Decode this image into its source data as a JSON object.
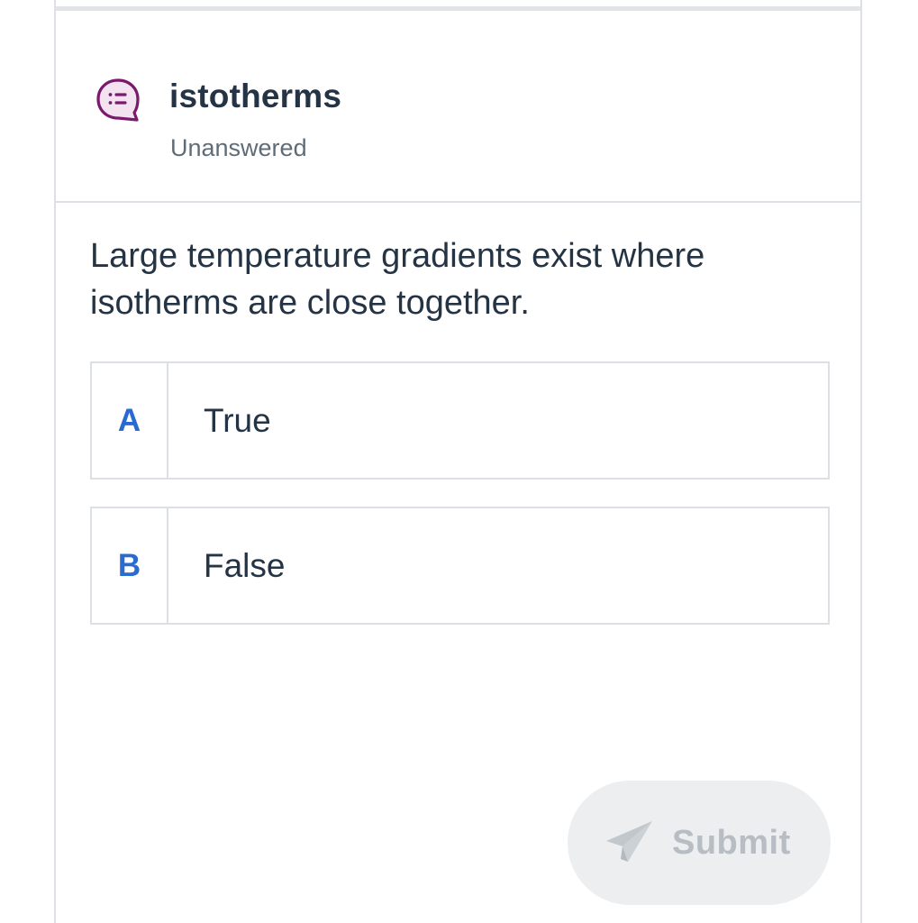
{
  "question": {
    "type_icon": "chat-bubble-list-icon",
    "title": "istotherms",
    "status": "Unanswered",
    "prompt": "Large temperature gradients exist where isotherms are close together."
  },
  "options": [
    {
      "letter": "A",
      "text": "True"
    },
    {
      "letter": "B",
      "text": "False"
    }
  ],
  "submit": {
    "icon": "paper-plane-icon",
    "label": "Submit",
    "enabled": false
  },
  "colors": {
    "title_text": "#243444",
    "status_text": "#5f6c78",
    "option_letter": "#2a6bd0",
    "icon_purple": "#7a1a6e",
    "submit_bg": "#eceef0",
    "submit_text": "#b7bdc3",
    "border": "#dde1e5"
  }
}
